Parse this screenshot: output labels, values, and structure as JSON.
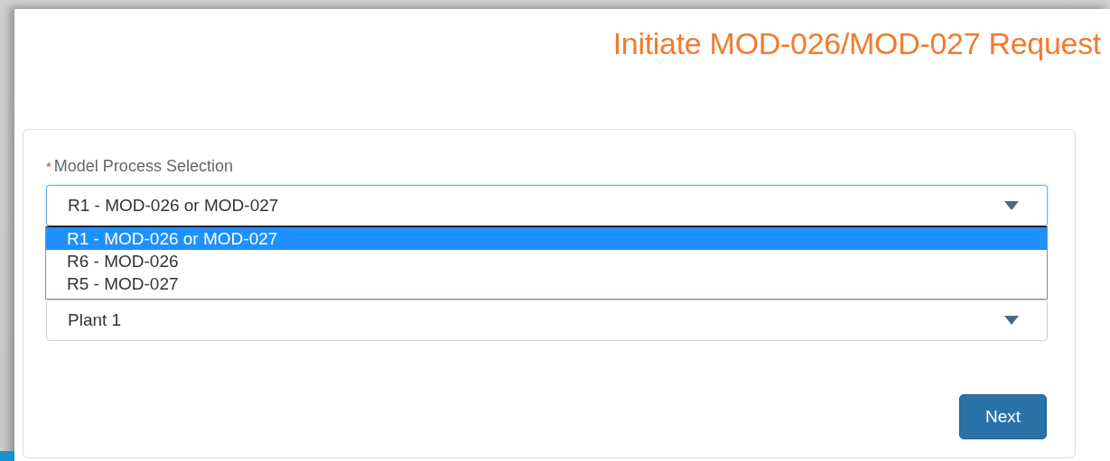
{
  "page": {
    "title": "Initiate MOD-026/MOD-027 Request"
  },
  "form": {
    "fields": [
      {
        "label": "Model Process Selection",
        "required_mark": "*",
        "value": "R1 - MOD-026 or MOD-027",
        "focused": true,
        "expanded": true,
        "options": [
          {
            "label": "R1 - MOD-026 or MOD-027",
            "selected": true
          },
          {
            "label": "R6 - MOD-026",
            "selected": false
          },
          {
            "label": "R5 - MOD-027",
            "selected": false
          }
        ]
      },
      {
        "value": "Plant 1",
        "focused": false,
        "expanded": false
      }
    ],
    "buttons": [
      {
        "label": "Next"
      }
    ]
  }
}
